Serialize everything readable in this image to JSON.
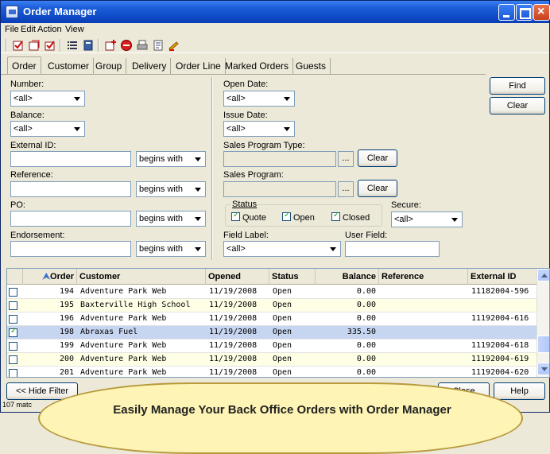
{
  "window": {
    "title": "Order Manager"
  },
  "menu": [
    "File",
    "Edit",
    "Action",
    "View"
  ],
  "toolbar_icons": [
    "check-list-icon",
    "uncheck-icon",
    "check-icon",
    "list-icon",
    "book-icon",
    "new-order-icon",
    "stop-icon",
    "print-icon",
    "report-icon",
    "pencil-icon"
  ],
  "tabs": [
    "Order",
    "Customer",
    "Group",
    "Delivery",
    "Order Line",
    "Marked Orders",
    "Guests"
  ],
  "filters": {
    "number": {
      "label": "Number:",
      "value": "<all>"
    },
    "balance": {
      "label": "Balance:",
      "value": "<all>"
    },
    "external_id": {
      "label": "External ID:",
      "mode": "begins with"
    },
    "reference": {
      "label": "Reference:",
      "mode": "begins with"
    },
    "po": {
      "label": "PO:",
      "mode": "begins with"
    },
    "endorsement": {
      "label": "Endorsement:",
      "mode": "begins with"
    },
    "open_date": {
      "label": "Open Date:",
      "value": "<all>"
    },
    "issue_date": {
      "label": "Issue Date:",
      "value": "<all>"
    },
    "sales_program_type": {
      "label": "Sales Program Type:",
      "browse": "...",
      "clear": "Clear"
    },
    "sales_program": {
      "label": "Sales Program:",
      "browse": "...",
      "clear": "Clear"
    },
    "status": {
      "label": "Status",
      "quote": "Quote",
      "open": "Open",
      "closed": "Closed"
    },
    "secure": {
      "label": "Secure:",
      "value": "<all>"
    },
    "field_label": {
      "label": "Field Label:",
      "value": "<all>"
    },
    "user_field": {
      "label": "User Field:"
    }
  },
  "actions": {
    "find": "Find",
    "clear": "Clear",
    "hide_filter": "<< Hide Filter",
    "close": "Close",
    "help": "Help"
  },
  "grid": {
    "columns": [
      "Order",
      "Customer",
      "Opened",
      "Status",
      "Balance",
      "Reference",
      "External ID"
    ],
    "rows": [
      {
        "checked": false,
        "order": "194",
        "customer": "Adventure Park Web",
        "opened": "11/19/2008",
        "status": "Open",
        "balance": "0.00",
        "reference": "",
        "external_id": "11182004-596"
      },
      {
        "checked": false,
        "order": "195",
        "customer": "Baxterville High School",
        "opened": "11/19/2008",
        "status": "Open",
        "balance": "0.00",
        "reference": "",
        "external_id": ""
      },
      {
        "checked": false,
        "order": "196",
        "customer": "Adventure Park Web",
        "opened": "11/19/2008",
        "status": "Open",
        "balance": "0.00",
        "reference": "",
        "external_id": "11192004-616"
      },
      {
        "checked": true,
        "order": "198",
        "customer": "Abraxas Fuel",
        "opened": "11/19/2008",
        "status": "Open",
        "balance": "335.50",
        "reference": "",
        "external_id": ""
      },
      {
        "checked": false,
        "order": "199",
        "customer": "Adventure Park Web",
        "opened": "11/19/2008",
        "status": "Open",
        "balance": "0.00",
        "reference": "",
        "external_id": "11192004-618"
      },
      {
        "checked": false,
        "order": "200",
        "customer": "Adventure Park Web",
        "opened": "11/19/2008",
        "status": "Open",
        "balance": "0.00",
        "reference": "",
        "external_id": "11192004-619"
      },
      {
        "checked": false,
        "order": "201",
        "customer": "Adventure Park Web",
        "opened": "11/19/2008",
        "status": "Open",
        "balance": "0.00",
        "reference": "",
        "external_id": "11192004-620"
      }
    ]
  },
  "status_text": "107 matc",
  "callout": "Easily Manage Your Back Office Orders with Order Manager"
}
